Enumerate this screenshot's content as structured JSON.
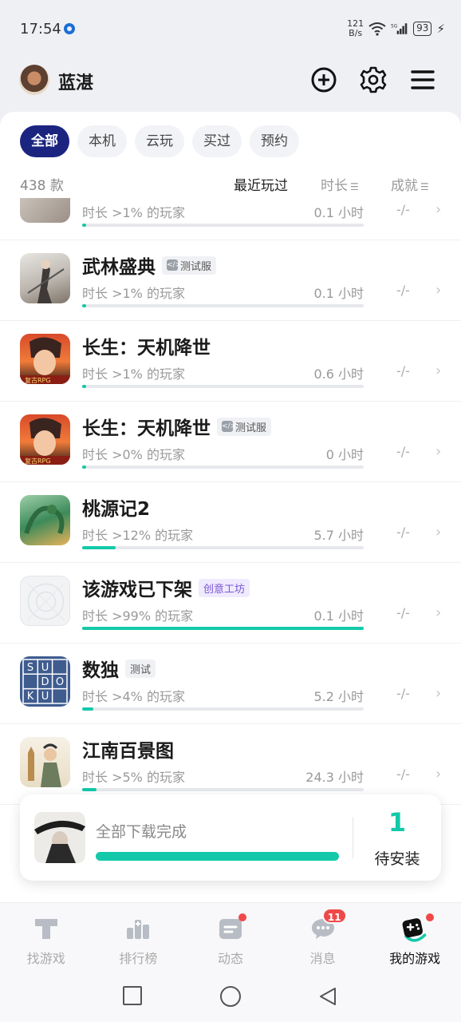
{
  "status_bar": {
    "time": "17:54",
    "net_speed_value": "121",
    "net_speed_unit": "B/s",
    "network_type": "5G",
    "battery": "93"
  },
  "header": {
    "username": "蓝湛"
  },
  "filters": {
    "tabs": [
      "全部",
      "本机",
      "云玩",
      "买过",
      "预约"
    ],
    "active": "全部"
  },
  "sort_bar": {
    "count": "438 款",
    "recent": "最近玩过",
    "duration": "时长",
    "achievement": "成就"
  },
  "games": [
    {
      "title": "",
      "badge": "",
      "subtitle": "时长 >1% 的玩家",
      "hours": "0.1 小时",
      "achievement": "-/-",
      "progress": 0.01
    },
    {
      "title": "武林盛典",
      "badge": "测试服",
      "subtitle": "时长 >1% 的玩家",
      "hours": "0.1 小时",
      "achievement": "-/-",
      "progress": 0.01
    },
    {
      "title": "长生：天机降世",
      "badge": "",
      "subtitle": "时长 >1% 的玩家",
      "hours": "0.6 小时",
      "achievement": "-/-",
      "progress": 0.01
    },
    {
      "title": "长生：天机降世",
      "badge": "测试服",
      "subtitle": "时长 >0% 的玩家",
      "hours": "0 小时",
      "achievement": "-/-",
      "progress": 0.01
    },
    {
      "title": "桃源记2",
      "badge": "",
      "subtitle": "时长 >12% 的玩家",
      "hours": "5.7 小时",
      "achievement": "-/-",
      "progress": 0.12
    },
    {
      "title": "该游戏已下架",
      "badge": "创意工坊",
      "subtitle": "时长 >99% 的玩家",
      "hours": "0.1 小时",
      "achievement": "-/-",
      "progress": 1.0
    },
    {
      "title": "数独",
      "badge": "测试",
      "subtitle": "时长 >4% 的玩家",
      "hours": "5.2 小时",
      "achievement": "-/-",
      "progress": 0.04
    },
    {
      "title": "江南百景图",
      "badge": "",
      "subtitle": "时长 >5% 的玩家",
      "hours": "24.3 小时",
      "achievement": "-/-",
      "progress": 0.05
    }
  ],
  "icon_text": {
    "rpg_label": "复古RPG",
    "sudoku_letters": [
      "S",
      "U",
      "",
      "",
      "D",
      "O",
      "K",
      "U",
      ""
    ]
  },
  "download": {
    "status": "全部下载完成",
    "progress": 1.0,
    "count": "1",
    "pending_label": "待安装"
  },
  "bottom_nav": {
    "items": [
      "找游戏",
      "排行榜",
      "动态",
      "消息",
      "我的游戏"
    ],
    "messages_badge": "11",
    "active": "我的游戏"
  },
  "colors": {
    "accent": "#13c9a9",
    "active_tab": "#1b2580",
    "badge_red": "#f04848"
  }
}
